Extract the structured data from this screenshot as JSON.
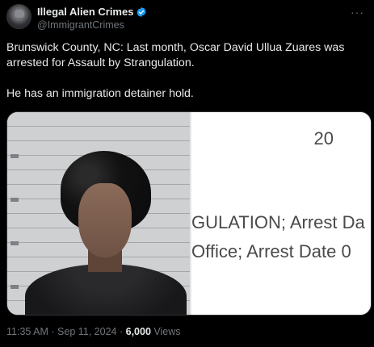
{
  "header": {
    "display_name": "Illegal Alien Crimes",
    "handle": "@ImmigrantCrimes",
    "more_icon": "more-horizontal-icon",
    "verified_color": "#1d9bf0"
  },
  "tweet": {
    "text": "Brunswick County, NC: Last month, Oscar David Ullua Zuares was arrested for Assault by Strangulation.\n\nHe has an immigration detainer hold."
  },
  "media": {
    "doc_year": "20",
    "doc_line1": "GULATION; Arrest Da",
    "doc_line2": "Office; Arrest Date 0"
  },
  "meta": {
    "time": "11:35 AM",
    "separator": "·",
    "date": "Sep 11, 2024",
    "views_count": "6,000",
    "views_label": "Views"
  }
}
